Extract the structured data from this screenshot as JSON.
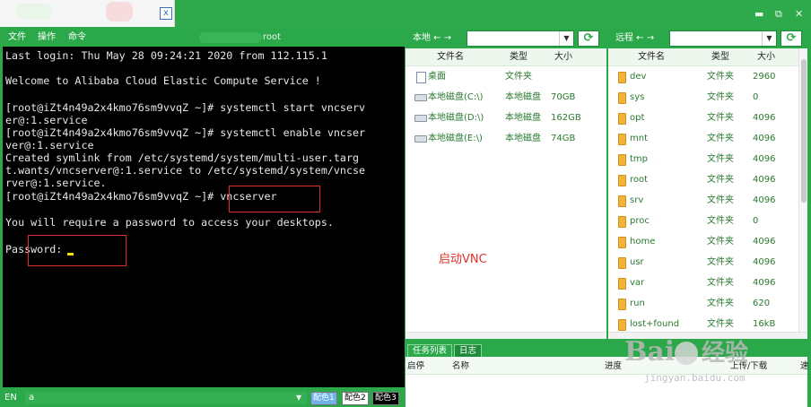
{
  "window": {
    "tab_close": "x",
    "minimize": "▬",
    "maximize": "⧉",
    "close": "✕"
  },
  "menu": {
    "file": "文件",
    "operate": "操作",
    "command": "命令",
    "host_suffix": "root"
  },
  "terminal": {
    "lines": [
      "Last login: Thu May 28 09:24:21 2020 from 112.115.1",
      "Welcome to Alibaba Cloud Elastic Compute Service !",
      "[root@iZt4n49a2x4kmo76sm9vvqZ ~]# systemctl start vncserv",
      "er@:1.service",
      "[root@iZt4n49a2x4kmo76sm9vvqZ ~]# systemctl enable vncser",
      "ver@:1.service",
      "Created symlink from /etc/systemd/system/multi-user.targ",
      "t.wants/vncserver@:1.service to /etc/systemd/system/vncse",
      "rver@:1.service.",
      "[root@iZt4n49a2x4kmo76sm9vvqZ ~]# vncserver",
      "You will require a password to access your desktops.",
      "Password:"
    ]
  },
  "statusbar": {
    "lang": "EN",
    "input_value": "a",
    "color1": "配色1",
    "color2": "配色2",
    "color3": "配色3"
  },
  "local": {
    "label": "本地 ← →",
    "headers": {
      "name": "文件名",
      "type": "类型",
      "size": "大小"
    },
    "rows": [
      {
        "name": "桌面",
        "type": "文件夹",
        "size": ""
      },
      {
        "name": "本地磁盘(C:\\)",
        "type": "本地磁盘",
        "size": "70GB"
      },
      {
        "name": "本地磁盘(D:\\)",
        "type": "本地磁盘",
        "size": "162GB"
      },
      {
        "name": "本地磁盘(E:\\)",
        "type": "本地磁盘",
        "size": "74GB"
      }
    ]
  },
  "remote": {
    "label": "远程 ← →",
    "headers": {
      "name": "文件名",
      "type": "类型",
      "size": "大小"
    },
    "rows": [
      {
        "name": "dev",
        "type": "文件夹",
        "size": "2960"
      },
      {
        "name": "sys",
        "type": "文件夹",
        "size": "0"
      },
      {
        "name": "opt",
        "type": "文件夹",
        "size": "4096"
      },
      {
        "name": "mnt",
        "type": "文件夹",
        "size": "4096"
      },
      {
        "name": "tmp",
        "type": "文件夹",
        "size": "4096"
      },
      {
        "name": "root",
        "type": "文件夹",
        "size": "4096"
      },
      {
        "name": "srv",
        "type": "文件夹",
        "size": "4096"
      },
      {
        "name": "proc",
        "type": "文件夹",
        "size": "0"
      },
      {
        "name": "home",
        "type": "文件夹",
        "size": "4096"
      },
      {
        "name": "usr",
        "type": "文件夹",
        "size": "4096"
      },
      {
        "name": "var",
        "type": "文件夹",
        "size": "4096"
      },
      {
        "name": "run",
        "type": "文件夹",
        "size": "620"
      },
      {
        "name": "lost+found",
        "type": "文件夹",
        "size": "16kB"
      }
    ]
  },
  "annotation": "启动VNC",
  "tasks": {
    "tab_list": "任务列表",
    "tab_log": "日志",
    "col_status": "启停",
    "col_name": "名称",
    "col_progress": "进度",
    "col_transfer": "上传/下载",
    "col_speed": "速"
  },
  "watermark": {
    "brand_left": "Bai",
    "brand_right": "经验",
    "sub": "jingyan.baidu.com"
  },
  "colors": {
    "accent": "#2aa84a",
    "terminal_bg": "#000000",
    "highlight": "#e0302b"
  }
}
